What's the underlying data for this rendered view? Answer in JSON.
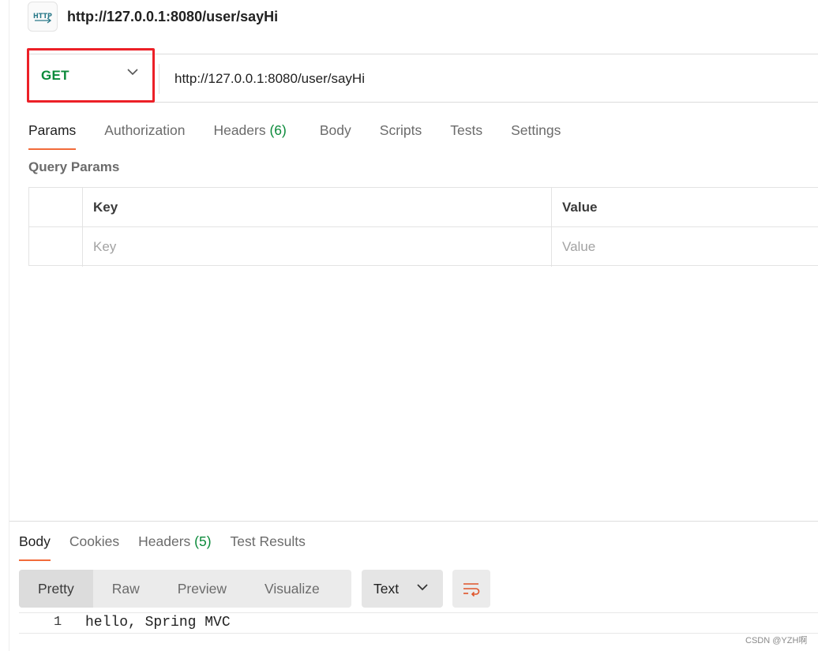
{
  "request": {
    "title": "http://127.0.0.1:8080/user/sayHi",
    "method": "GET",
    "url": "http://127.0.0.1:8080/user/sayHi",
    "http_icon_label": "HTTP"
  },
  "request_tabs": [
    {
      "label": "Params"
    },
    {
      "label": "Authorization"
    },
    {
      "label": "Headers",
      "count": "(6)"
    },
    {
      "label": "Body"
    },
    {
      "label": "Scripts"
    },
    {
      "label": "Tests"
    },
    {
      "label": "Settings"
    }
  ],
  "query_params": {
    "title": "Query Params",
    "columns": {
      "key": "Key",
      "value": "Value"
    },
    "placeholders": {
      "key": "Key",
      "value": "Value"
    }
  },
  "response_tabs": [
    {
      "label": "Body"
    },
    {
      "label": "Cookies"
    },
    {
      "label": "Headers",
      "count": "(5)"
    },
    {
      "label": "Test Results"
    }
  ],
  "response_toolbar": {
    "views": [
      "Pretty",
      "Raw",
      "Preview",
      "Visualize"
    ],
    "format": "Text"
  },
  "response_body": {
    "line_number": "1",
    "text": "hello, Spring MVC"
  },
  "watermark": "CSDN @YZH啊",
  "colors": {
    "method_get": "#0b8a3a",
    "highlight_box": "#ec2027",
    "active_tab_underline": "#f26b3a",
    "wrap_icon": "#e0542a"
  }
}
